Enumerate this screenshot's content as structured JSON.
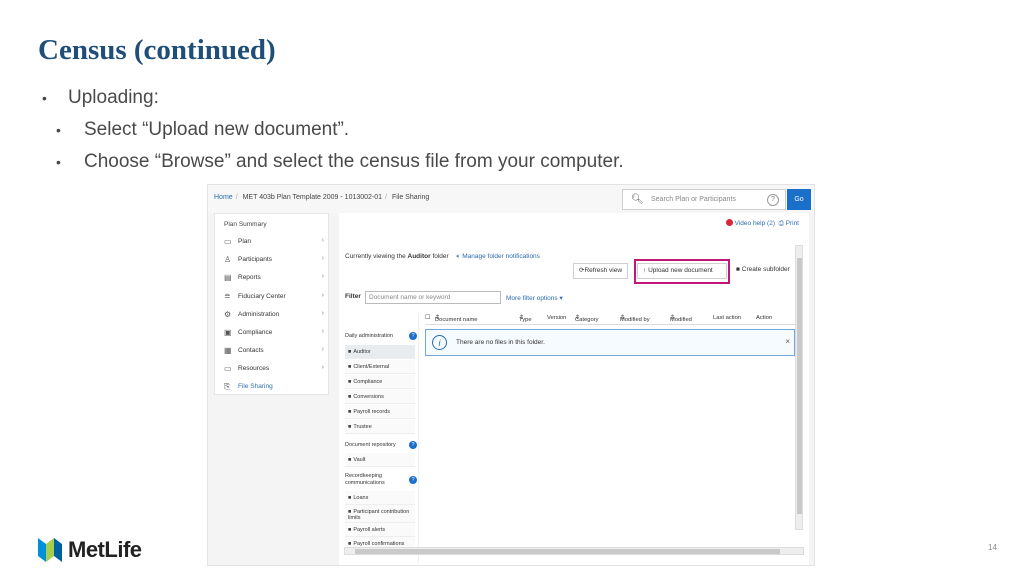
{
  "slide": {
    "title": "Census (continued)",
    "bullets": [
      "Uploading:",
      "Select “Upload new document”.",
      "Choose “Browse” and select the census file from your computer."
    ],
    "bullet_char": "•",
    "page_number": "14",
    "logo_text": "MetLife"
  },
  "app": {
    "breadcrumb": [
      "Home",
      "MET 403b Plan Template 2009 - 1013002-01",
      "File Sharing"
    ],
    "search": {
      "placeholder": "Search Plan or Participants",
      "help": "?",
      "go": "Go"
    },
    "nav": {
      "title": "Plan Summary",
      "items": [
        {
          "label": "Plan",
          "icon": "document-icon"
        },
        {
          "label": "Participants",
          "icon": "people-icon"
        },
        {
          "label": "Reports",
          "icon": "report-icon"
        },
        {
          "label": "Fiduciary Center",
          "icon": "database-icon"
        },
        {
          "label": "Administration",
          "icon": "gear-icon"
        },
        {
          "label": "Compliance",
          "icon": "compliance-icon"
        },
        {
          "label": "Contacts",
          "icon": "contacts-icon"
        },
        {
          "label": "Resources",
          "icon": "folder-icon"
        },
        {
          "label": "File Sharing",
          "icon": "file-icon"
        }
      ]
    },
    "help_links": {
      "video": "Video help (2)",
      "print": "Print"
    },
    "viewing": {
      "prefix": "Currently viewing the",
      "folder": "Auditor",
      "suffix": "folder",
      "manage": "Manage folder notifications"
    },
    "buttons": {
      "refresh": "Refresh view",
      "upload": "Upload new document",
      "subfolder": "Create subfolder"
    },
    "filter": {
      "label": "Filter",
      "placeholder": "Document name or keyword",
      "more": "More filter options"
    },
    "folders": {
      "daily_title": "Daily administration",
      "daily": [
        "Auditor",
        "Client/External",
        "Compliance",
        "Conversions",
        "Payroll records",
        "Trustee"
      ],
      "repo_title": "Document repository",
      "repo": [
        "Vault"
      ],
      "recordkeeping_title": "Recordkeeping communications",
      "recordkeeping": [
        "Loans",
        "Participant contribution limits",
        "Payroll alerts",
        "Payroll confirmations"
      ]
    },
    "table": {
      "columns": [
        "Document name",
        "Type",
        "Version",
        "Category",
        "Modified by",
        "Modified",
        "Last action",
        "Action"
      ],
      "empty_message": "There are no files in this folder."
    },
    "colors": {
      "title": "#1f4e79",
      "highlight": "#c0177a",
      "go_button": "#1a6fc9",
      "link": "#2b6cb0"
    }
  }
}
